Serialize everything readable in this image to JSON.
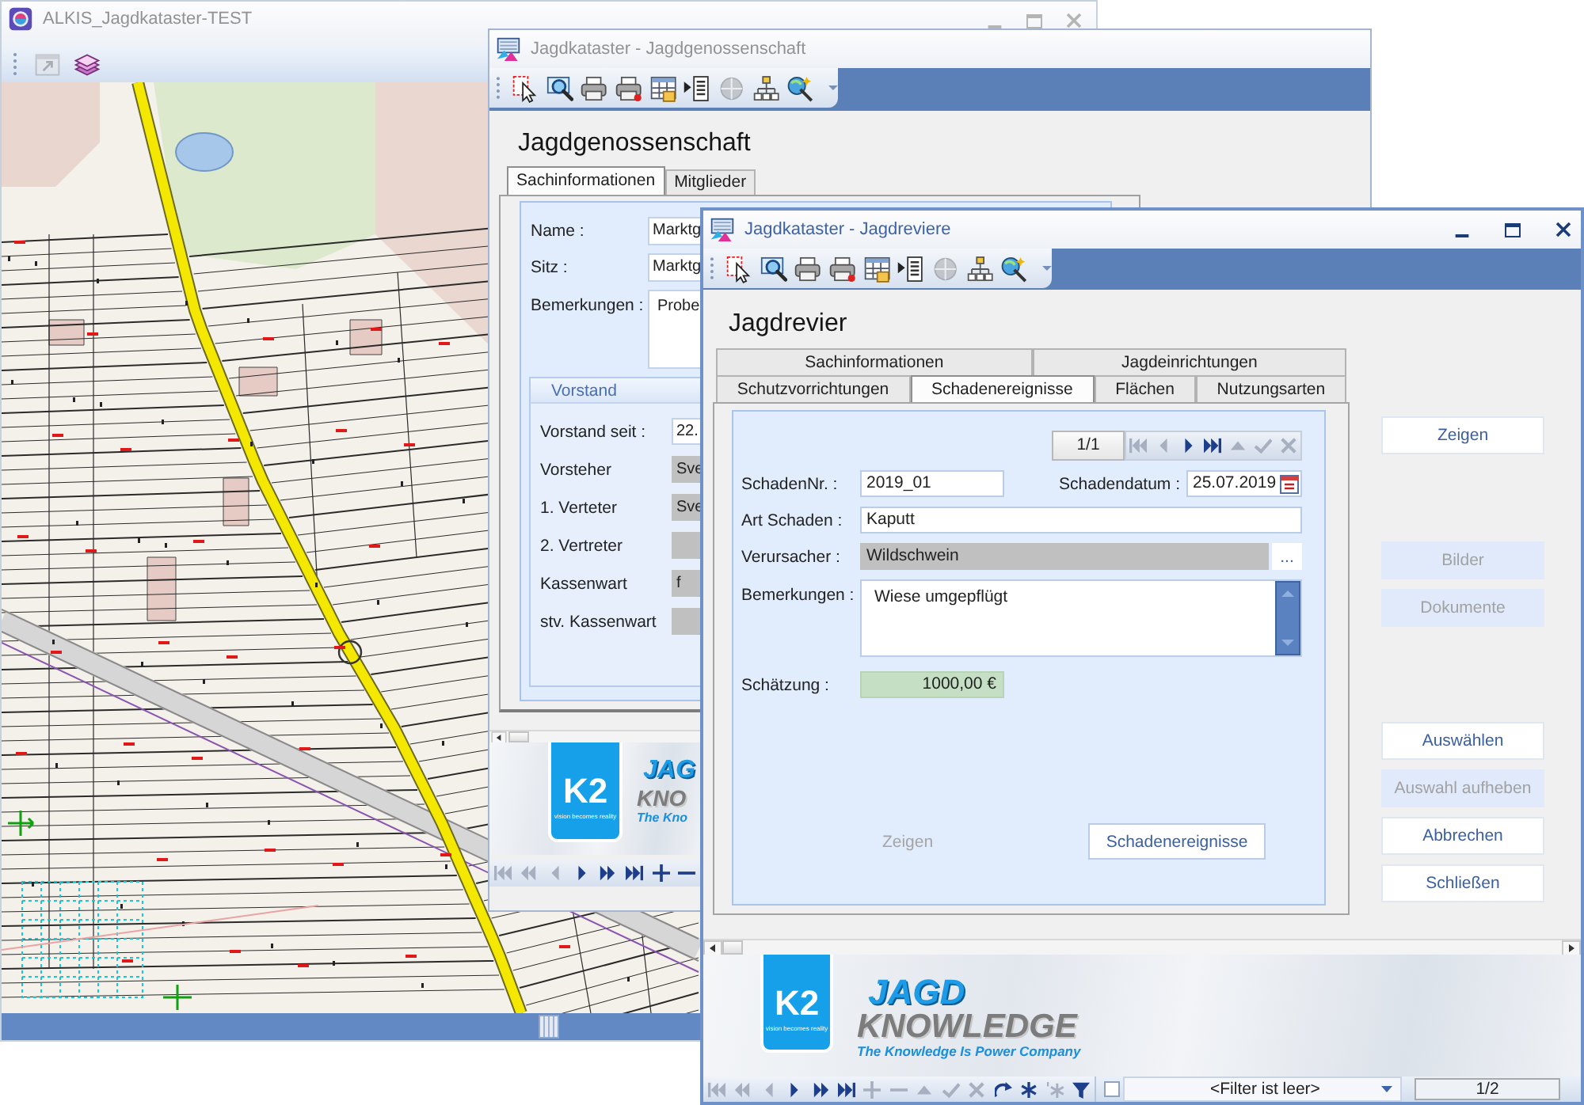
{
  "map_window": {
    "title": "ALKIS_Jagdkataster-TEST",
    "active": false,
    "toolbar": [
      {
        "kind": "window",
        "disabled": true
      },
      {
        "kind": "layers",
        "disabled": false
      }
    ]
  },
  "genossenschaft_window": {
    "title": "Jagdkataster - Jagdgenossenschaft",
    "active": false,
    "toolbar": [
      {
        "kind": "select",
        "disabled": false
      },
      {
        "kind": "zoom",
        "disabled": false
      },
      {
        "kind": "print",
        "disabled": false
      },
      {
        "kind": "print_marked",
        "disabled": false
      },
      {
        "kind": "table",
        "disabled": false
      },
      {
        "kind": "export",
        "disabled": false
      },
      {
        "kind": "globe",
        "disabled": true
      },
      {
        "kind": "tree",
        "disabled": false
      },
      {
        "kind": "wand",
        "disabled": false
      }
    ],
    "heading": "Jagdgenossenschaft",
    "tabs": [
      {
        "label": "Sachinformationen",
        "selected": true
      },
      {
        "label": "Mitglieder",
        "selected": false
      }
    ],
    "fields": [
      {
        "label": "Name :",
        "value": "Marktg",
        "kind": "text"
      },
      {
        "label": "Sitz :",
        "value": "Marktg",
        "kind": "text"
      },
      {
        "label": "Bemerkungen :",
        "value": "Probe",
        "kind": "memo"
      }
    ],
    "group": {
      "title": "Vorstand",
      "fields": [
        {
          "label": "Vorstand seit :",
          "value": "22.",
          "kind": "text"
        },
        {
          "label": "Vorsteher",
          "value": "Sve",
          "kind": "lookup"
        },
        {
          "label": "1. Verteter",
          "value": "Sve",
          "kind": "lookup"
        },
        {
          "label": "2. Vertreter",
          "kind": "lookup"
        },
        {
          "label": "Kassenwart",
          "value": "f",
          "kind": "lookup"
        },
        {
          "label": "stv. Kassenwart",
          "kind": "lookup"
        }
      ]
    },
    "banner": {
      "logo": "K2",
      "logo_tagline": "vision becomes reality",
      "title": "JAG",
      "subtitle": "KNO",
      "slogan": "The Kno"
    },
    "navigator": [
      {
        "kind": "first",
        "disabled": true
      },
      {
        "kind": "prev_page",
        "disabled": true
      },
      {
        "kind": "prev",
        "disabled": true
      },
      {
        "kind": "next",
        "disabled": false
      },
      {
        "kind": "next_page",
        "disabled": false
      },
      {
        "kind": "last",
        "disabled": false
      },
      {
        "kind": "add",
        "disabled": false
      },
      {
        "kind": "remove",
        "disabled": false
      }
    ]
  },
  "revier_window": {
    "title": "Jagdkataster - Jagdreviere",
    "active": true,
    "toolbar": [
      {
        "kind": "select",
        "disabled": false
      },
      {
        "kind": "zoom",
        "disabled": false
      },
      {
        "kind": "print",
        "disabled": false
      },
      {
        "kind": "print_marked",
        "disabled": false
      },
      {
        "kind": "table",
        "disabled": false
      },
      {
        "kind": "export",
        "disabled": false
      },
      {
        "kind": "globe",
        "disabled": true
      },
      {
        "kind": "tree",
        "disabled": false
      },
      {
        "kind": "wand",
        "disabled": false
      }
    ],
    "heading": "Jagdrevier",
    "tab_rows": [
      [
        {
          "label": "Sachinformationen",
          "selected": false
        },
        {
          "label": "Jagdeinrichtungen",
          "selected": false
        }
      ],
      [
        {
          "label": "Schutzvorrichtungen",
          "selected": false
        },
        {
          "label": "Schadenereignisse",
          "selected": true
        },
        {
          "label": "Flächen",
          "selected": false
        },
        {
          "label": "Nutzungsarten",
          "selected": false
        }
      ]
    ],
    "record_counter": "1/1",
    "record_navigator": [
      {
        "kind": "first",
        "disabled": true
      },
      {
        "kind": "prev",
        "disabled": true
      },
      {
        "kind": "next",
        "disabled": false
      },
      {
        "kind": "last",
        "disabled": false
      },
      {
        "kind": "up",
        "disabled": true
      },
      {
        "kind": "save",
        "disabled": true
      },
      {
        "kind": "cancel",
        "disabled": true
      }
    ],
    "form_rows": [
      [
        {
          "label": "SchadenNr. :",
          "value": "2019_01",
          "kind": "text"
        },
        {
          "label": "Schadendatum :",
          "value": "25.07.2019",
          "kind": "date"
        }
      ],
      [
        {
          "label": "Art Schaden :",
          "value": "Kaputt",
          "kind": "text"
        }
      ],
      [
        {
          "label": "Verursacher :",
          "value": "Wildschwein",
          "kind": "lookup",
          "button": "..."
        }
      ],
      [
        {
          "label": "Bemerkungen :",
          "value": "Wiese umgepflügt",
          "kind": "memo"
        }
      ],
      [
        {
          "label": "Schätzung :",
          "value": "1000,00 €",
          "kind": "amount"
        }
      ]
    ],
    "form_buttons": [
      {
        "label": "Zeigen",
        "disabled": true
      },
      {
        "label": "Schadenereignisse",
        "disabled": false
      }
    ],
    "side_button_groups": [
      [
        {
          "label": "Zeigen",
          "disabled": false
        }
      ],
      [
        {
          "label": "Bilder",
          "disabled": true
        },
        {
          "label": "Dokumente",
          "disabled": true
        }
      ],
      [
        {
          "label": "Auswählen",
          "disabled": false
        },
        {
          "label": "Auswahl aufheben",
          "disabled": true
        },
        {
          "label": "Abbrechen",
          "disabled": false
        },
        {
          "label": "Schließen",
          "disabled": false
        }
      ]
    ],
    "banner": {
      "logo": "K2",
      "logo_tagline": "vision becomes reality",
      "title": "JAGD",
      "subtitle": "KNOWLEDGE",
      "slogan": "The Knowledge Is Power Company"
    },
    "navigator": [
      {
        "kind": "first",
        "disabled": true
      },
      {
        "kind": "prev_page",
        "disabled": true
      },
      {
        "kind": "prev",
        "disabled": true
      },
      {
        "kind": "next",
        "disabled": false
      },
      {
        "kind": "next_page",
        "disabled": false
      },
      {
        "kind": "last",
        "disabled": false
      },
      {
        "kind": "add",
        "disabled": true
      },
      {
        "kind": "remove",
        "disabled": true
      },
      {
        "kind": "up",
        "disabled": true
      },
      {
        "kind": "save",
        "disabled": true
      },
      {
        "kind": "cancel",
        "disabled": true
      },
      {
        "kind": "refresh",
        "disabled": false
      },
      {
        "kind": "find",
        "disabled": false
      },
      {
        "kind": "find_next",
        "disabled": true
      },
      {
        "kind": "filter",
        "disabled": false
      }
    ],
    "filter": {
      "checked": false,
      "text": "<Filter ist leer>"
    },
    "page_counter": "1/2"
  }
}
